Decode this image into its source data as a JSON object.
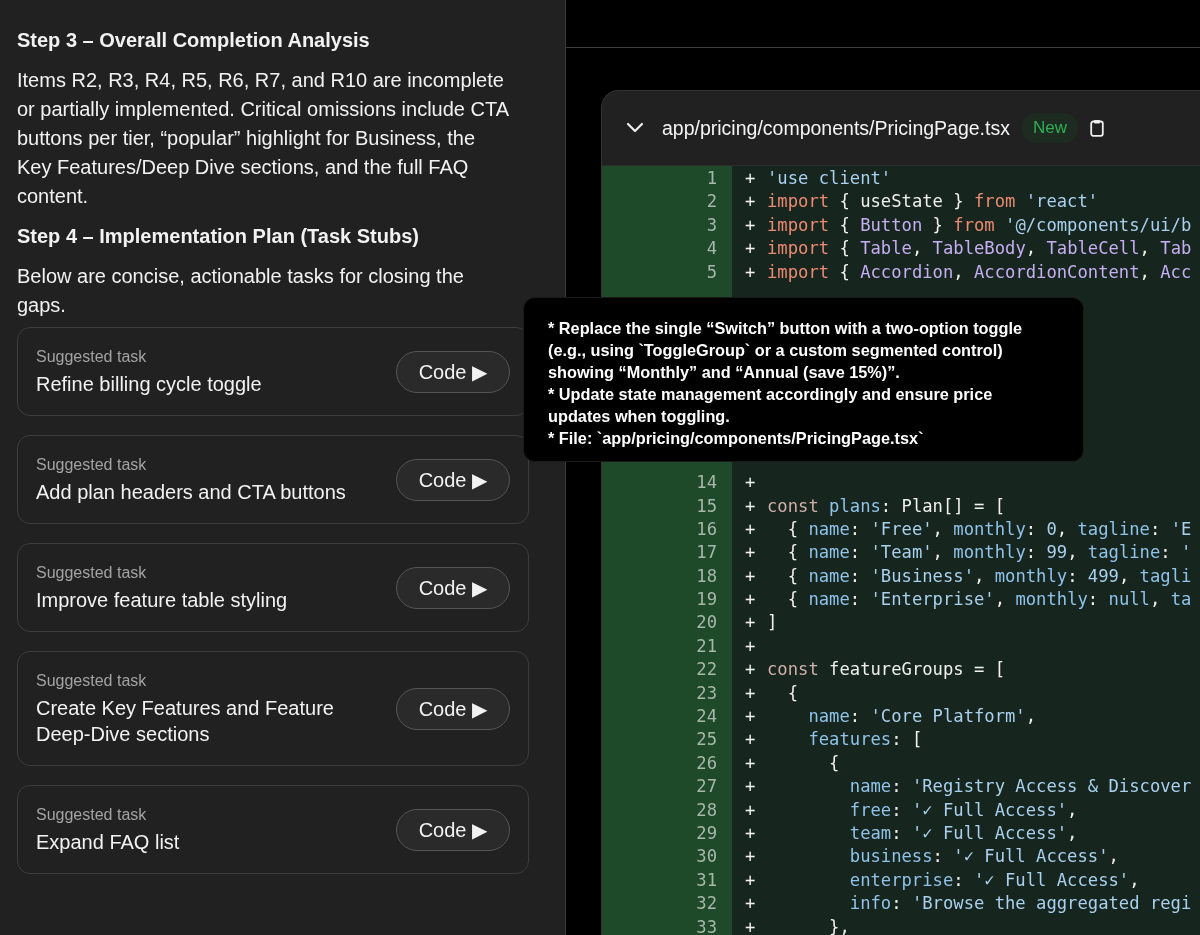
{
  "analysis": {
    "heading": "Step 3 – Overall Completion Analysis",
    "text": "Items R2, R3, R4, R5, R6, R7, and R10 are incomplete or partially implemented. Critical omissions include CTA buttons per tier, “popular” highlight for Business, the Key Features/Deep Dive sections, and the full FAQ content."
  },
  "plan": {
    "heading": "Step 4 – Implementation Plan (Task Stubs)",
    "text": "Below are concise, actionable tasks for closing the gaps."
  },
  "tasks": [
    {
      "label": "Suggested task",
      "title": "Refine billing cycle toggle",
      "button": "Code ▶"
    },
    {
      "label": "Suggested task",
      "title": "Add plan headers and CTA buttons",
      "button": "Code ▶"
    },
    {
      "label": "Suggested task",
      "title": "Improve feature table styling",
      "button": "Code ▶"
    },
    {
      "label": "Suggested task",
      "title": "Create Key Features and Feature Deep-Dive sections",
      "button": "Code ▶"
    },
    {
      "label": "Suggested task",
      "title": "Expand FAQ list",
      "button": "Code ▶"
    }
  ],
  "tooltip": [
    "* Replace the single “Switch” button with a two-option toggle (e.g., using `ToggleGroup` or a custom segmented control) showing “Monthly” and “Annual (save 15%)”.",
    "* Update state management accordingly and ensure price updates when toggling.",
    "* File: `app/pricing/components/PricingPage.tsx`"
  ],
  "file": {
    "path": "app/pricing/components/PricingPage.tsx",
    "badge": "New"
  },
  "code_lines": [
    {
      "number": "1",
      "sign": "+",
      "tokens": [
        {
          "kind": "string",
          "text": "'use client'"
        }
      ]
    },
    {
      "number": "2",
      "sign": "+",
      "tokens": [
        {
          "kind": "keyword",
          "text": "import"
        },
        {
          "kind": "plain",
          "text": " { useState } "
        },
        {
          "kind": "keyword",
          "text": "from"
        },
        {
          "kind": "string",
          "text": " 'react'"
        }
      ]
    },
    {
      "number": "3",
      "sign": "+",
      "tokens": [
        {
          "kind": "keyword",
          "text": "import"
        },
        {
          "kind": "plain",
          "text": " { "
        },
        {
          "kind": "type",
          "text": "Button"
        },
        {
          "kind": "plain",
          "text": " } "
        },
        {
          "kind": "keyword",
          "text": "from"
        },
        {
          "kind": "string",
          "text": " '@/components/ui/b"
        }
      ]
    },
    {
      "number": "4",
      "sign": "+",
      "tokens": [
        {
          "kind": "keyword",
          "text": "import"
        },
        {
          "kind": "plain",
          "text": " { "
        },
        {
          "kind": "type",
          "text": "Table"
        },
        {
          "kind": "plain",
          "text": ", "
        },
        {
          "kind": "type",
          "text": "TableBody"
        },
        {
          "kind": "plain",
          "text": ", "
        },
        {
          "kind": "type",
          "text": "TableCell"
        },
        {
          "kind": "plain",
          "text": ", "
        },
        {
          "kind": "type",
          "text": "Tab"
        }
      ]
    },
    {
      "number": "5",
      "sign": "+",
      "tokens": [
        {
          "kind": "keyword",
          "text": "import"
        },
        {
          "kind": "plain",
          "text": " { "
        },
        {
          "kind": "type",
          "text": "Accordion"
        },
        {
          "kind": "plain",
          "text": ", "
        },
        {
          "kind": "type",
          "text": "AccordionContent"
        },
        {
          "kind": "plain",
          "text": ", "
        },
        {
          "kind": "type",
          "text": "Acc"
        }
      ]
    },
    {
      "number": "14",
      "sign": "+"
    },
    {
      "number": "15",
      "sign": "+",
      "tokens": [
        {
          "kind": "storage",
          "text": "const"
        },
        {
          "kind": "prop",
          "text": " plans"
        },
        {
          "kind": "plain",
          "text": ": Plan[] = ["
        }
      ]
    },
    {
      "number": "16",
      "sign": "+",
      "tokens": [
        {
          "kind": "plain",
          "text": "  { "
        },
        {
          "kind": "prop",
          "text": "name"
        },
        {
          "kind": "plain",
          "text": ": "
        },
        {
          "kind": "string",
          "text": "'Free'"
        },
        {
          "kind": "plain",
          "text": ", "
        },
        {
          "kind": "prop",
          "text": "monthly"
        },
        {
          "kind": "plain",
          "text": ": "
        },
        {
          "kind": "string",
          "text": "0"
        },
        {
          "kind": "plain",
          "text": ", "
        },
        {
          "kind": "prop",
          "text": "tagline"
        },
        {
          "kind": "plain",
          "text": ": "
        },
        {
          "kind": "string",
          "text": "'E"
        }
      ]
    },
    {
      "number": "17",
      "sign": "+",
      "tokens": [
        {
          "kind": "plain",
          "text": "  { "
        },
        {
          "kind": "prop",
          "text": "name"
        },
        {
          "kind": "plain",
          "text": ": "
        },
        {
          "kind": "string",
          "text": "'Team'"
        },
        {
          "kind": "plain",
          "text": ", "
        },
        {
          "kind": "prop",
          "text": "monthly"
        },
        {
          "kind": "plain",
          "text": ": "
        },
        {
          "kind": "string",
          "text": "99"
        },
        {
          "kind": "plain",
          "text": ", "
        },
        {
          "kind": "prop",
          "text": "tagline"
        },
        {
          "kind": "plain",
          "text": ": "
        },
        {
          "kind": "string",
          "text": "'"
        }
      ]
    },
    {
      "number": "18",
      "sign": "+",
      "tokens": [
        {
          "kind": "plain",
          "text": "  { "
        },
        {
          "kind": "prop",
          "text": "name"
        },
        {
          "kind": "plain",
          "text": ": "
        },
        {
          "kind": "string",
          "text": "'Business'"
        },
        {
          "kind": "plain",
          "text": ", "
        },
        {
          "kind": "prop",
          "text": "monthly"
        },
        {
          "kind": "plain",
          "text": ": "
        },
        {
          "kind": "string",
          "text": "499"
        },
        {
          "kind": "plain",
          "text": ", "
        },
        {
          "kind": "prop",
          "text": "tagli"
        }
      ]
    },
    {
      "number": "19",
      "sign": "+",
      "tokens": [
        {
          "kind": "plain",
          "text": "  { "
        },
        {
          "kind": "prop",
          "text": "name"
        },
        {
          "kind": "plain",
          "text": ": "
        },
        {
          "kind": "string",
          "text": "'Enterprise'"
        },
        {
          "kind": "plain",
          "text": ", "
        },
        {
          "kind": "prop",
          "text": "monthly"
        },
        {
          "kind": "plain",
          "text": ": "
        },
        {
          "kind": "prop",
          "text": "null"
        },
        {
          "kind": "plain",
          "text": ", "
        },
        {
          "kind": "prop",
          "text": "ta"
        }
      ]
    },
    {
      "number": "20",
      "sign": "+",
      "tokens": [
        {
          "kind": "plain",
          "text": "]"
        }
      ]
    },
    {
      "number": "21",
      "sign": "+"
    },
    {
      "number": "22",
      "sign": "+",
      "tokens": [
        {
          "kind": "storage",
          "text": "const"
        },
        {
          "kind": "plain",
          "text": " featureGroups = ["
        }
      ]
    },
    {
      "number": "23",
      "sign": "+",
      "tokens": [
        {
          "kind": "plain",
          "text": "  {"
        }
      ]
    },
    {
      "number": "24",
      "sign": "+",
      "tokens": [
        {
          "kind": "prop",
          "text": "    name"
        },
        {
          "kind": "plain",
          "text": ": "
        },
        {
          "kind": "string",
          "text": "'Core Platform'"
        },
        {
          "kind": "plain",
          "text": ","
        }
      ]
    },
    {
      "number": "25",
      "sign": "+",
      "tokens": [
        {
          "kind": "prop",
          "text": "    features"
        },
        {
          "kind": "plain",
          "text": ": ["
        }
      ]
    },
    {
      "number": "26",
      "sign": "+",
      "tokens": [
        {
          "kind": "plain",
          "text": "      {"
        }
      ]
    },
    {
      "number": "27",
      "sign": "+",
      "tokens": [
        {
          "kind": "prop",
          "text": "        name"
        },
        {
          "kind": "plain",
          "text": ": "
        },
        {
          "kind": "string",
          "text": "'Registry Access & Discover"
        }
      ]
    },
    {
      "number": "28",
      "sign": "+",
      "tokens": [
        {
          "kind": "prop",
          "text": "        free"
        },
        {
          "kind": "plain",
          "text": ": "
        },
        {
          "kind": "string",
          "text": "'✓ Full Access'"
        },
        {
          "kind": "plain",
          "text": ","
        }
      ]
    },
    {
      "number": "29",
      "sign": "+",
      "tokens": [
        {
          "kind": "prop",
          "text": "        team"
        },
        {
          "kind": "plain",
          "text": ": "
        },
        {
          "kind": "string",
          "text": "'✓ Full Access'"
        },
        {
          "kind": "plain",
          "text": ","
        }
      ]
    },
    {
      "number": "30",
      "sign": "+",
      "tokens": [
        {
          "kind": "prop",
          "text": "        business"
        },
        {
          "kind": "plain",
          "text": ": "
        },
        {
          "kind": "string",
          "text": "'✓ Full Access'"
        },
        {
          "kind": "plain",
          "text": ","
        }
      ]
    },
    {
      "number": "31",
      "sign": "+",
      "tokens": [
        {
          "kind": "prop",
          "text": "        enterprise"
        },
        {
          "kind": "plain",
          "text": ": "
        },
        {
          "kind": "string",
          "text": "'✓ Full Access'"
        },
        {
          "kind": "plain",
          "text": ","
        }
      ]
    },
    {
      "number": "32",
      "sign": "+",
      "tokens": [
        {
          "kind": "prop",
          "text": "        info"
        },
        {
          "kind": "plain",
          "text": ": "
        },
        {
          "kind": "string",
          "text": "'Browse the aggregated regi"
        }
      ]
    },
    {
      "number": "33",
      "sign": "+",
      "tokens": [
        {
          "kind": "plain",
          "text": "      },"
        }
      ]
    }
  ]
}
